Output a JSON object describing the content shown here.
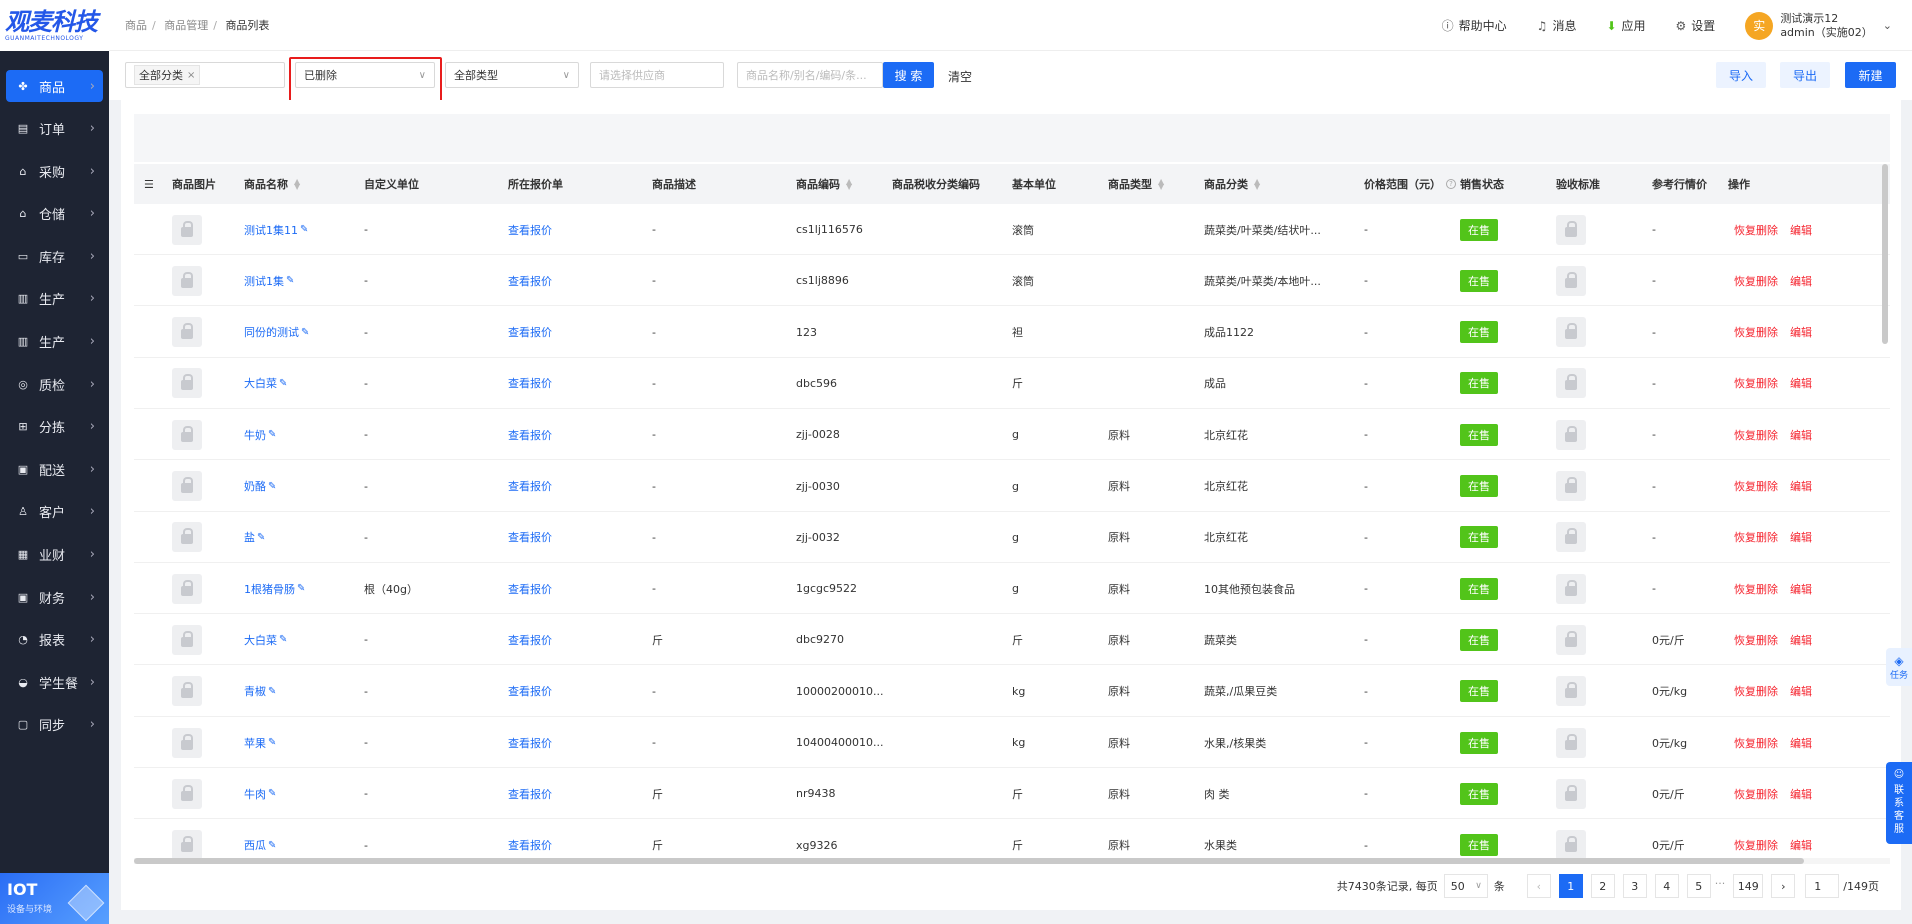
{
  "brand": {
    "name": "观麦科技",
    "sub": "GUANMAITECHNOLOGY"
  },
  "breadcrumb": [
    "商品",
    "商品管理",
    "商品列表"
  ],
  "sidebar": {
    "items": [
      {
        "label": "商品",
        "icon": "grid-icon",
        "active": true
      },
      {
        "label": "订单",
        "icon": "order-icon"
      },
      {
        "label": "采购",
        "icon": "basket-icon"
      },
      {
        "label": "仓储",
        "icon": "warehouse-icon"
      },
      {
        "label": "库存",
        "icon": "inventory-icon"
      },
      {
        "label": "生产",
        "icon": "factory-icon"
      },
      {
        "label": "生产",
        "icon": "factory-icon"
      },
      {
        "label": "质检",
        "icon": "shield-icon"
      },
      {
        "label": "分拣",
        "icon": "sort-icon"
      },
      {
        "label": "配送",
        "icon": "truck-icon"
      },
      {
        "label": "客户",
        "icon": "user-icon"
      },
      {
        "label": "业财",
        "icon": "chart-icon"
      },
      {
        "label": "财务",
        "icon": "wallet-icon"
      },
      {
        "label": "报表",
        "icon": "report-icon"
      },
      {
        "label": "学生餐",
        "icon": "meal-icon"
      },
      {
        "label": "同步",
        "icon": "sync-icon"
      }
    ],
    "iot": {
      "title": "IOT",
      "subtitle": "设备与环境"
    }
  },
  "header": {
    "help": "帮助中心",
    "messages": "消息",
    "apps": "应用",
    "settings": "设置",
    "avatar_text": "实",
    "user_name": "测试演示12",
    "user_account": "admin（实施02）"
  },
  "filters": {
    "category_tag": "全部分类",
    "status_value": "已删除",
    "type_value": "全部类型",
    "supplier_placeholder": "请选择供应商",
    "search_placeholder": "商品名称/别名/编码/条...",
    "search_btn": "搜 索",
    "clear_btn": "清空",
    "import_btn": "导入",
    "export_btn": "导出",
    "new_btn": "新建"
  },
  "table": {
    "headers": {
      "image": "商品图片",
      "name": "商品名称",
      "custom_unit": "自定义单位",
      "quote": "所在报价单",
      "desc": "商品描述",
      "code": "商品编码",
      "tax_code": "商品税收分类编码",
      "base_unit": "基本单位",
      "type": "商品类型",
      "category": "商品分类",
      "price_range": "价格范围（元）",
      "sale_status": "销售状态",
      "acceptance": "验收标准",
      "ref_price": "参考行情价",
      "actions": "操作"
    },
    "quote_link": "查看报价",
    "restore": "恢复删除",
    "edit": "编辑",
    "rows": [
      {
        "name": "测试1集11",
        "custom_unit": "-",
        "desc": "-",
        "code": "cs1lj116576",
        "base_unit": "滚筒",
        "type": "",
        "category": "蔬菜类/叶菜类/结状叶...",
        "price": "-",
        "status": "在售",
        "ref": "-"
      },
      {
        "name": "测试1集",
        "custom_unit": "-",
        "desc": "-",
        "code": "cs1lj8896",
        "base_unit": "滚筒",
        "type": "",
        "category": "蔬菜类/叶菜类/本地叶...",
        "price": "-",
        "status": "在售",
        "ref": "-"
      },
      {
        "name": "同份的测试",
        "custom_unit": "-",
        "desc": "-",
        "code": "123",
        "base_unit": "袒",
        "type": "",
        "category": "成品1122",
        "price": "-",
        "status": "在售",
        "ref": "-"
      },
      {
        "name": "大白菜",
        "custom_unit": "-",
        "desc": "-",
        "code": "dbc596",
        "base_unit": "斤",
        "type": "",
        "category": "成品",
        "price": "-",
        "status": "在售",
        "ref": "-"
      },
      {
        "name": "牛奶",
        "custom_unit": "-",
        "desc": "-",
        "code": "zjj-0028",
        "base_unit": "g",
        "type": "原料",
        "category": "北京红花",
        "price": "-",
        "status": "在售",
        "ref": "-"
      },
      {
        "name": "奶酪",
        "custom_unit": "-",
        "desc": "-",
        "code": "zjj-0030",
        "base_unit": "g",
        "type": "原料",
        "category": "北京红花",
        "price": "-",
        "status": "在售",
        "ref": "-"
      },
      {
        "name": "盐",
        "custom_unit": "-",
        "desc": "-",
        "code": "zjj-0032",
        "base_unit": "g",
        "type": "原料",
        "category": "北京红花",
        "price": "-",
        "status": "在售",
        "ref": "-"
      },
      {
        "name": "1根猪骨肠",
        "custom_unit": "根（40g）",
        "desc": "-",
        "code": "1gcgc9522",
        "base_unit": "g",
        "type": "原料",
        "category": "10其他预包装食品",
        "price": "-",
        "status": "在售",
        "ref": "-"
      },
      {
        "name": "大白菜",
        "custom_unit": "-",
        "desc": "斤",
        "code": "dbc9270",
        "base_unit": "斤",
        "type": "原料",
        "category": "蔬菜类",
        "price": "-",
        "status": "在售",
        "ref": "0元/斤"
      },
      {
        "name": "青椒",
        "custom_unit": "-",
        "desc": "-",
        "code": "10000200010...",
        "base_unit": "kg",
        "type": "原料",
        "category": "蔬菜,/瓜果豆类",
        "price": "-",
        "status": "在售",
        "ref": "0元/kg"
      },
      {
        "name": "苹果",
        "custom_unit": "-",
        "desc": "-",
        "code": "10400400010...",
        "base_unit": "kg",
        "type": "原料",
        "category": "水果,/核果类",
        "price": "-",
        "status": "在售",
        "ref": "0元/kg"
      },
      {
        "name": "牛肉",
        "custom_unit": "-",
        "desc": "斤",
        "code": "nr9438",
        "base_unit": "斤",
        "type": "原料",
        "category": "肉 类",
        "price": "-",
        "status": "在售",
        "ref": "0元/斤"
      },
      {
        "name": "西瓜",
        "custom_unit": "-",
        "desc": "斤",
        "code": "xg9326",
        "base_unit": "斤",
        "type": "原料",
        "category": "水果类",
        "price": "-",
        "status": "在售",
        "ref": "0元/斤"
      }
    ]
  },
  "pagination": {
    "total_text": "共7430条记录, 每页",
    "page_size": "50",
    "unit": "条",
    "pages": [
      "1",
      "2",
      "3",
      "4",
      "5",
      "...",
      "149"
    ],
    "current": "1",
    "jump_value": "1",
    "total_pages": "/149页"
  },
  "floating": {
    "task": "任务",
    "contact": [
      "联",
      "系",
      "客",
      "服"
    ]
  }
}
